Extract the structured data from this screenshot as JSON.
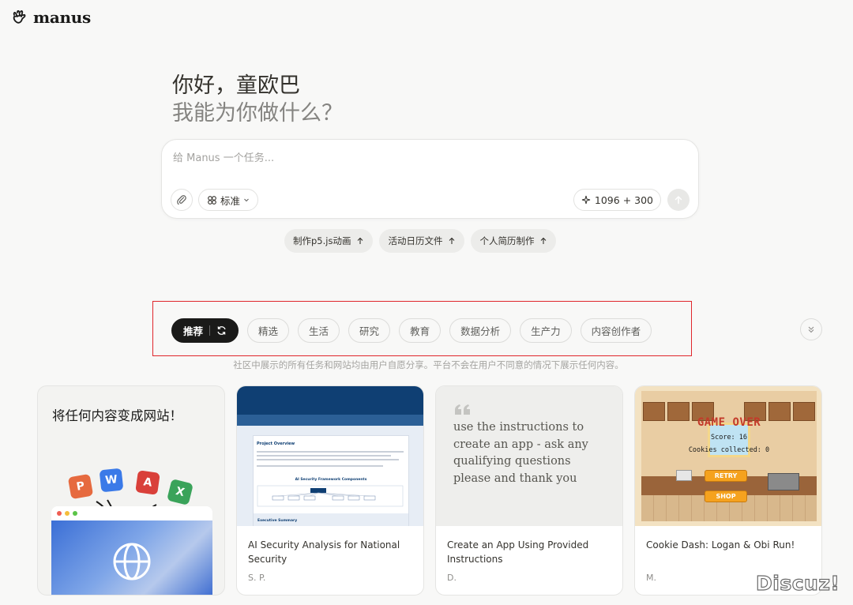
{
  "app": {
    "name": "manus"
  },
  "greeting": {
    "line1": "你好，童欧巴",
    "line2": "我能为你做什么？"
  },
  "input": {
    "placeholder": "给 Manus 一个任务...",
    "mode_label": "标准",
    "credits": "1096 + 300"
  },
  "suggestions": [
    {
      "label": "制作p5.js动画"
    },
    {
      "label": "活动日历文件"
    },
    {
      "label": "个人简历制作"
    }
  ],
  "filters": {
    "active": "推荐",
    "items": [
      "精选",
      "生活",
      "研究",
      "教育",
      "数据分析",
      "生产力",
      "内容创作者"
    ]
  },
  "disclaimer": "社区中展示的所有任务和网站均由用户自愿分享。平台不会在用户不同意的情况下展示任何内容。",
  "cards": [
    {
      "preview_heading": "将任何内容变成网站！",
      "icons": [
        "P",
        "W",
        "A",
        "X"
      ],
      "title": "",
      "author": ""
    },
    {
      "doc_heading": "Project Overview",
      "doc_section": "AI Security Framework Components",
      "doc_section2": "Executive Summary",
      "title": "AI Security Analysis for National Security",
      "author": "S. P."
    },
    {
      "quote": "use the instructions to create an app - ask any qualifying questions please and thank you",
      "title": "Create an App Using Provided Instructions",
      "author": "D."
    },
    {
      "game": {
        "heading": "GAME OVER",
        "score": "Score: 16",
        "cookies": "Cookies collected: 0",
        "retry": "RETRY",
        "shop": "SHOP"
      },
      "title": "Cookie Dash: Logan & Obi Run!",
      "author": "M."
    }
  ],
  "watermark": "Discuz!",
  "colors": {
    "accent_dark": "#1a1a19",
    "highlight_border": "#e0262b",
    "background": "#f8f8f7"
  }
}
